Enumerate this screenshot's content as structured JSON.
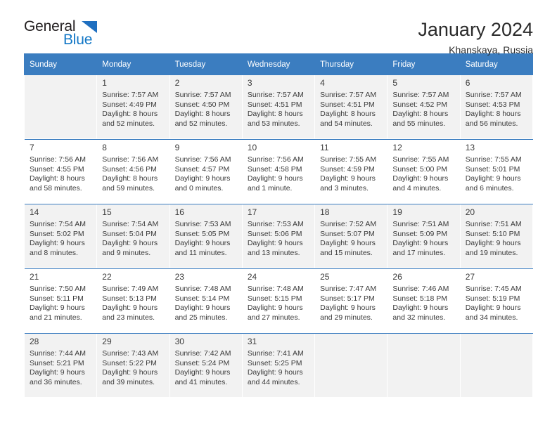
{
  "brand": {
    "name_top": "General",
    "name_bottom": "Blue",
    "triangle_color": "#1f6fc0",
    "blue_text_color": "#1277c6"
  },
  "header": {
    "title": "January 2024",
    "subtitle": "Khanskaya, Russia"
  },
  "theme": {
    "header_bg": "#3b7dc0",
    "header_text": "#ffffff",
    "row_shade": "#f2f2f2",
    "row_plain": "#ffffff",
    "text": "#3a3a3a"
  },
  "calendar": {
    "weekdays": [
      "Sunday",
      "Monday",
      "Tuesday",
      "Wednesday",
      "Thursday",
      "Friday",
      "Saturday"
    ],
    "weeks": [
      [
        {
          "day": "",
          "sunrise": "",
          "sunset": "",
          "daylight1": "",
          "daylight2": ""
        },
        {
          "day": "1",
          "sunrise": "Sunrise: 7:57 AM",
          "sunset": "Sunset: 4:49 PM",
          "daylight1": "Daylight: 8 hours",
          "daylight2": "and 52 minutes."
        },
        {
          "day": "2",
          "sunrise": "Sunrise: 7:57 AM",
          "sunset": "Sunset: 4:50 PM",
          "daylight1": "Daylight: 8 hours",
          "daylight2": "and 52 minutes."
        },
        {
          "day": "3",
          "sunrise": "Sunrise: 7:57 AM",
          "sunset": "Sunset: 4:51 PM",
          "daylight1": "Daylight: 8 hours",
          "daylight2": "and 53 minutes."
        },
        {
          "day": "4",
          "sunrise": "Sunrise: 7:57 AM",
          "sunset": "Sunset: 4:51 PM",
          "daylight1": "Daylight: 8 hours",
          "daylight2": "and 54 minutes."
        },
        {
          "day": "5",
          "sunrise": "Sunrise: 7:57 AM",
          "sunset": "Sunset: 4:52 PM",
          "daylight1": "Daylight: 8 hours",
          "daylight2": "and 55 minutes."
        },
        {
          "day": "6",
          "sunrise": "Sunrise: 7:57 AM",
          "sunset": "Sunset: 4:53 PM",
          "daylight1": "Daylight: 8 hours",
          "daylight2": "and 56 minutes."
        }
      ],
      [
        {
          "day": "7",
          "sunrise": "Sunrise: 7:56 AM",
          "sunset": "Sunset: 4:55 PM",
          "daylight1": "Daylight: 8 hours",
          "daylight2": "and 58 minutes."
        },
        {
          "day": "8",
          "sunrise": "Sunrise: 7:56 AM",
          "sunset": "Sunset: 4:56 PM",
          "daylight1": "Daylight: 8 hours",
          "daylight2": "and 59 minutes."
        },
        {
          "day": "9",
          "sunrise": "Sunrise: 7:56 AM",
          "sunset": "Sunset: 4:57 PM",
          "daylight1": "Daylight: 9 hours",
          "daylight2": "and 0 minutes."
        },
        {
          "day": "10",
          "sunrise": "Sunrise: 7:56 AM",
          "sunset": "Sunset: 4:58 PM",
          "daylight1": "Daylight: 9 hours",
          "daylight2": "and 1 minute."
        },
        {
          "day": "11",
          "sunrise": "Sunrise: 7:55 AM",
          "sunset": "Sunset: 4:59 PM",
          "daylight1": "Daylight: 9 hours",
          "daylight2": "and 3 minutes."
        },
        {
          "day": "12",
          "sunrise": "Sunrise: 7:55 AM",
          "sunset": "Sunset: 5:00 PM",
          "daylight1": "Daylight: 9 hours",
          "daylight2": "and 4 minutes."
        },
        {
          "day": "13",
          "sunrise": "Sunrise: 7:55 AM",
          "sunset": "Sunset: 5:01 PM",
          "daylight1": "Daylight: 9 hours",
          "daylight2": "and 6 minutes."
        }
      ],
      [
        {
          "day": "14",
          "sunrise": "Sunrise: 7:54 AM",
          "sunset": "Sunset: 5:02 PM",
          "daylight1": "Daylight: 9 hours",
          "daylight2": "and 8 minutes."
        },
        {
          "day": "15",
          "sunrise": "Sunrise: 7:54 AM",
          "sunset": "Sunset: 5:04 PM",
          "daylight1": "Daylight: 9 hours",
          "daylight2": "and 9 minutes."
        },
        {
          "day": "16",
          "sunrise": "Sunrise: 7:53 AM",
          "sunset": "Sunset: 5:05 PM",
          "daylight1": "Daylight: 9 hours",
          "daylight2": "and 11 minutes."
        },
        {
          "day": "17",
          "sunrise": "Sunrise: 7:53 AM",
          "sunset": "Sunset: 5:06 PM",
          "daylight1": "Daylight: 9 hours",
          "daylight2": "and 13 minutes."
        },
        {
          "day": "18",
          "sunrise": "Sunrise: 7:52 AM",
          "sunset": "Sunset: 5:07 PM",
          "daylight1": "Daylight: 9 hours",
          "daylight2": "and 15 minutes."
        },
        {
          "day": "19",
          "sunrise": "Sunrise: 7:51 AM",
          "sunset": "Sunset: 5:09 PM",
          "daylight1": "Daylight: 9 hours",
          "daylight2": "and 17 minutes."
        },
        {
          "day": "20",
          "sunrise": "Sunrise: 7:51 AM",
          "sunset": "Sunset: 5:10 PM",
          "daylight1": "Daylight: 9 hours",
          "daylight2": "and 19 minutes."
        }
      ],
      [
        {
          "day": "21",
          "sunrise": "Sunrise: 7:50 AM",
          "sunset": "Sunset: 5:11 PM",
          "daylight1": "Daylight: 9 hours",
          "daylight2": "and 21 minutes."
        },
        {
          "day": "22",
          "sunrise": "Sunrise: 7:49 AM",
          "sunset": "Sunset: 5:13 PM",
          "daylight1": "Daylight: 9 hours",
          "daylight2": "and 23 minutes."
        },
        {
          "day": "23",
          "sunrise": "Sunrise: 7:48 AM",
          "sunset": "Sunset: 5:14 PM",
          "daylight1": "Daylight: 9 hours",
          "daylight2": "and 25 minutes."
        },
        {
          "day": "24",
          "sunrise": "Sunrise: 7:48 AM",
          "sunset": "Sunset: 5:15 PM",
          "daylight1": "Daylight: 9 hours",
          "daylight2": "and 27 minutes."
        },
        {
          "day": "25",
          "sunrise": "Sunrise: 7:47 AM",
          "sunset": "Sunset: 5:17 PM",
          "daylight1": "Daylight: 9 hours",
          "daylight2": "and 29 minutes."
        },
        {
          "day": "26",
          "sunrise": "Sunrise: 7:46 AM",
          "sunset": "Sunset: 5:18 PM",
          "daylight1": "Daylight: 9 hours",
          "daylight2": "and 32 minutes."
        },
        {
          "day": "27",
          "sunrise": "Sunrise: 7:45 AM",
          "sunset": "Sunset: 5:19 PM",
          "daylight1": "Daylight: 9 hours",
          "daylight2": "and 34 minutes."
        }
      ],
      [
        {
          "day": "28",
          "sunrise": "Sunrise: 7:44 AM",
          "sunset": "Sunset: 5:21 PM",
          "daylight1": "Daylight: 9 hours",
          "daylight2": "and 36 minutes."
        },
        {
          "day": "29",
          "sunrise": "Sunrise: 7:43 AM",
          "sunset": "Sunset: 5:22 PM",
          "daylight1": "Daylight: 9 hours",
          "daylight2": "and 39 minutes."
        },
        {
          "day": "30",
          "sunrise": "Sunrise: 7:42 AM",
          "sunset": "Sunset: 5:24 PM",
          "daylight1": "Daylight: 9 hours",
          "daylight2": "and 41 minutes."
        },
        {
          "day": "31",
          "sunrise": "Sunrise: 7:41 AM",
          "sunset": "Sunset: 5:25 PM",
          "daylight1": "Daylight: 9 hours",
          "daylight2": "and 44 minutes."
        },
        {
          "day": "",
          "sunrise": "",
          "sunset": "",
          "daylight1": "",
          "daylight2": ""
        },
        {
          "day": "",
          "sunrise": "",
          "sunset": "",
          "daylight1": "",
          "daylight2": ""
        },
        {
          "day": "",
          "sunrise": "",
          "sunset": "",
          "daylight1": "",
          "daylight2": ""
        }
      ]
    ]
  }
}
